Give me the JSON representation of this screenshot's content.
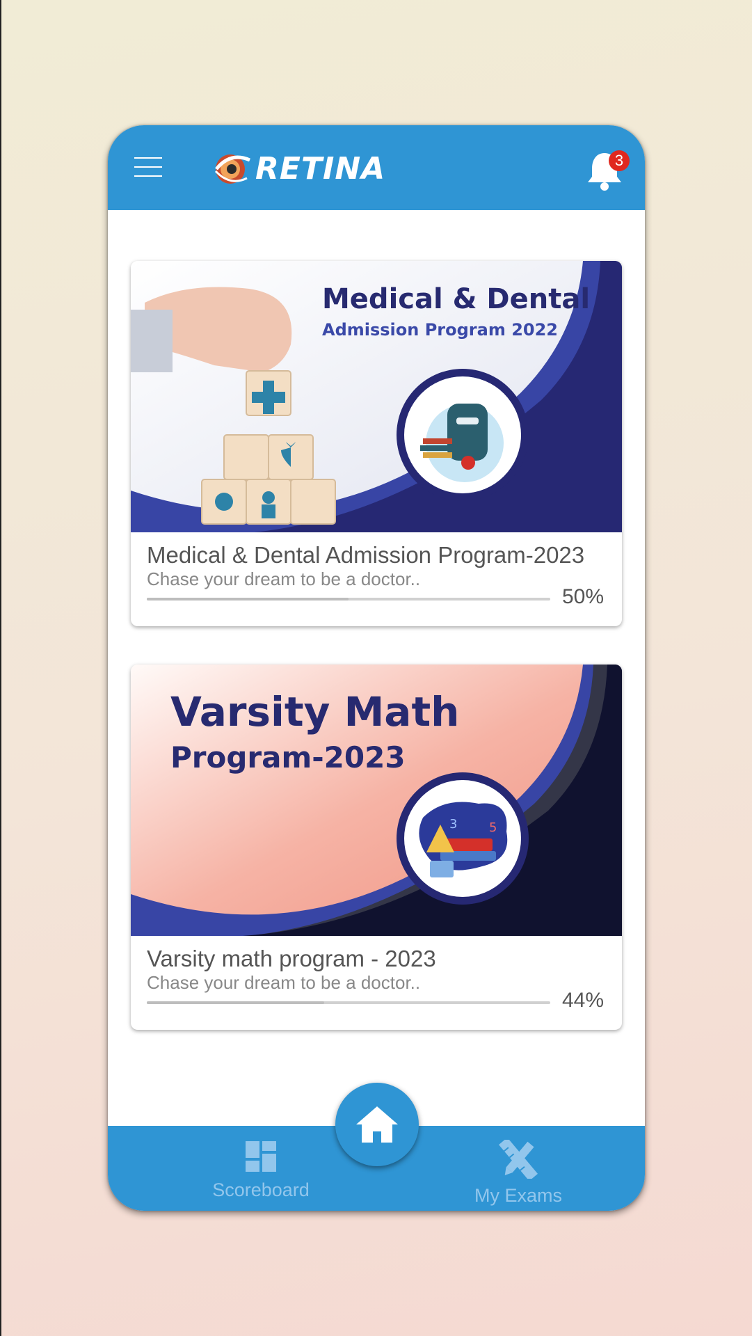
{
  "header": {
    "logo_text": "RETINA",
    "notification_count": "3"
  },
  "courses": [
    {
      "banner_title": "Medical & Dental",
      "banner_subtitle": "Admission Program 2022",
      "title": "Medical & Dental Admission Program-2023",
      "subtitle": "Chase your dream to be a doctor..",
      "progress_label": "50%",
      "progress": 50
    },
    {
      "banner_title": "Varsity Math",
      "banner_subtitle": "Program-2023",
      "title": "Varsity math program - 2023",
      "subtitle": "Chase your dream to be a doctor..",
      "progress_label": "44%",
      "progress": 44
    }
  ],
  "bottom_nav": {
    "scoreboard_label": "Scoreboard",
    "my_exams_label": "My Exams"
  },
  "colors": {
    "primary": "#2f95d4",
    "navy": "#2a2d7c",
    "badge": "#e0281f"
  }
}
